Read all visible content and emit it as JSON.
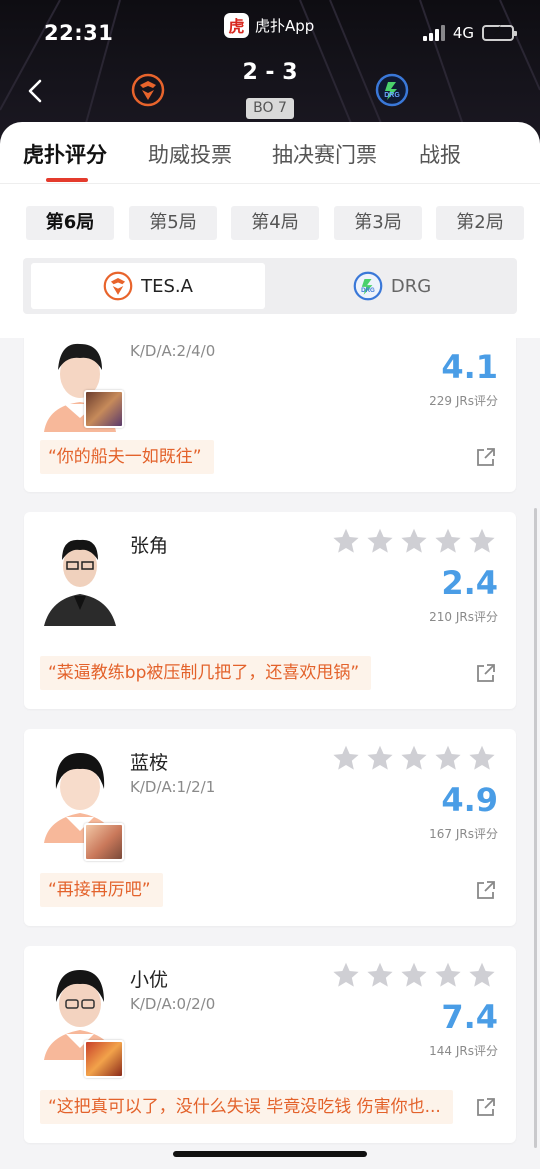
{
  "status_bar": {
    "time": "22:31",
    "app_name": "虎扑App",
    "app_logo_char": "虎",
    "network": "4G"
  },
  "match": {
    "score": "2 - 3",
    "format": "BO 7",
    "home_team": "TES.A",
    "away_team": "DRG"
  },
  "tabs": [
    {
      "label": "虎扑评分",
      "active": true
    },
    {
      "label": "助威投票",
      "active": false
    },
    {
      "label": "抽决赛门票",
      "active": false
    },
    {
      "label": "战报",
      "active": false
    }
  ],
  "games": [
    {
      "label": "第6局",
      "active": true
    },
    {
      "label": "第5局",
      "active": false
    },
    {
      "label": "第4局",
      "active": false
    },
    {
      "label": "第3局",
      "active": false
    },
    {
      "label": "第2局",
      "active": false
    }
  ],
  "team_toggle": {
    "home": "TES.A",
    "away": "DRG",
    "selected": "home"
  },
  "players": [
    {
      "name": "",
      "kda": "K/D/A:2/4/0",
      "rating": "4.1",
      "votes": "229 JRs评分",
      "quote": "“你的船夫一如既往”",
      "stars_filled": 0
    },
    {
      "name": "张角",
      "kda": "",
      "rating": "2.4",
      "votes": "210 JRs评分",
      "quote": "“菜逼教练bp被压制几把了，还喜欢甩锅”",
      "stars_filled": 0
    },
    {
      "name": "蓝桉",
      "kda": "K/D/A:1/2/1",
      "rating": "4.9",
      "votes": "167 JRs评分",
      "quote": "“再接再厉吧”",
      "stars_filled": 0
    },
    {
      "name": "小优",
      "kda": "K/D/A:0/2/0",
      "rating": "7.4",
      "votes": "144 JRs评分",
      "quote": "“这把真可以了，没什么失误 毕竟没吃钱 伤害你也...",
      "stars_filled": 0
    }
  ],
  "colors": {
    "accent": "#e43b2d",
    "rating": "#4a9de6",
    "quote_text": "#e3622b",
    "quote_bg": "#fdf3ea",
    "home_team": "#e8642c",
    "away_team": "#3a78d8"
  },
  "icons": {
    "back": "chevron-left-icon",
    "star": "star-icon",
    "share": "share-icon"
  }
}
